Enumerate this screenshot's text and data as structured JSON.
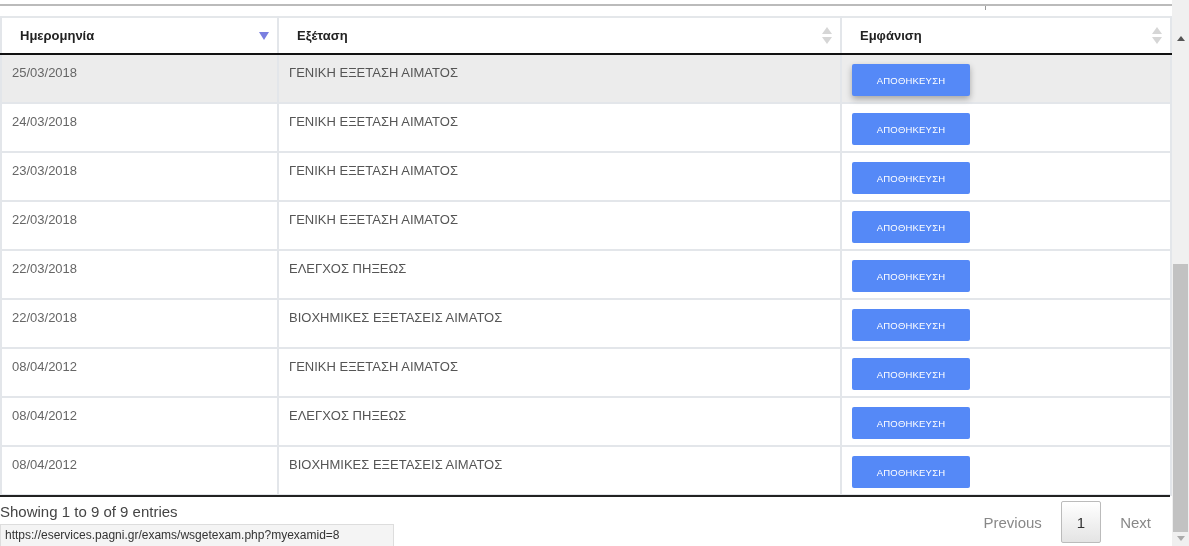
{
  "table": {
    "columns": [
      {
        "label": "Ημερομηνία",
        "sorted": true
      },
      {
        "label": "Εξέταση",
        "sorted": false
      },
      {
        "label": "Εμφάνιση",
        "sorted": false
      }
    ],
    "rows": [
      {
        "date": "25/03/2018",
        "exam": "ΓΕΝΙΚΗ ΕΞΕΤΑΣΗ ΑΙΜΑΤΟΣ",
        "action": "ΑΠΟΘΗΚΕΥΣΗ",
        "selected": true
      },
      {
        "date": "24/03/2018",
        "exam": "ΓΕΝΙΚΗ ΕΞΕΤΑΣΗ ΑΙΜΑΤΟΣ",
        "action": "ΑΠΟΘΗΚΕΥΣΗ",
        "selected": false
      },
      {
        "date": "23/03/2018",
        "exam": "ΓΕΝΙΚΗ ΕΞΕΤΑΣΗ ΑΙΜΑΤΟΣ",
        "action": "ΑΠΟΘΗΚΕΥΣΗ",
        "selected": false
      },
      {
        "date": "22/03/2018",
        "exam": "ΓΕΝΙΚΗ ΕΞΕΤΑΣΗ ΑΙΜΑΤΟΣ",
        "action": "ΑΠΟΘΗΚΕΥΣΗ",
        "selected": false
      },
      {
        "date": "22/03/2018",
        "exam": "ΕΛΕΓΧΟΣ ΠΗΞΕΩΣ",
        "action": "ΑΠΟΘΗΚΕΥΣΗ",
        "selected": false
      },
      {
        "date": "22/03/2018",
        "exam": "ΒΙΟΧΗΜΙΚΕΣ ΕΞΕΤΑΣΕΙΣ ΑΙΜΑΤΟΣ",
        "action": "ΑΠΟΘΗΚΕΥΣΗ",
        "selected": false
      },
      {
        "date": "08/04/2012",
        "exam": "ΓΕΝΙΚΗ ΕΞΕΤΑΣΗ ΑΙΜΑΤΟΣ",
        "action": "ΑΠΟΘΗΚΕΥΣΗ",
        "selected": false
      },
      {
        "date": "08/04/2012",
        "exam": "ΕΛΕΓΧΟΣ ΠΗΞΕΩΣ",
        "action": "ΑΠΟΘΗΚΕΥΣΗ",
        "selected": false
      },
      {
        "date": "08/04/2012",
        "exam": "ΒΙΟΧΗΜΙΚΕΣ ΕΞΕΤΑΣΕΙΣ ΑΙΜΑΤΟΣ",
        "action": "ΑΠΟΘΗΚΕΥΣΗ",
        "selected": false
      }
    ]
  },
  "info": "Showing 1 to 9 of 9 entries",
  "pagination": [
    {
      "label": "Previous",
      "selected": false
    },
    {
      "label": "1",
      "selected": true
    },
    {
      "label": "Next",
      "selected": false
    }
  ],
  "status_bar": {
    "url": "https://eservices.pagni.gr/exams/wsgetexam.php?myexamid=8"
  }
}
